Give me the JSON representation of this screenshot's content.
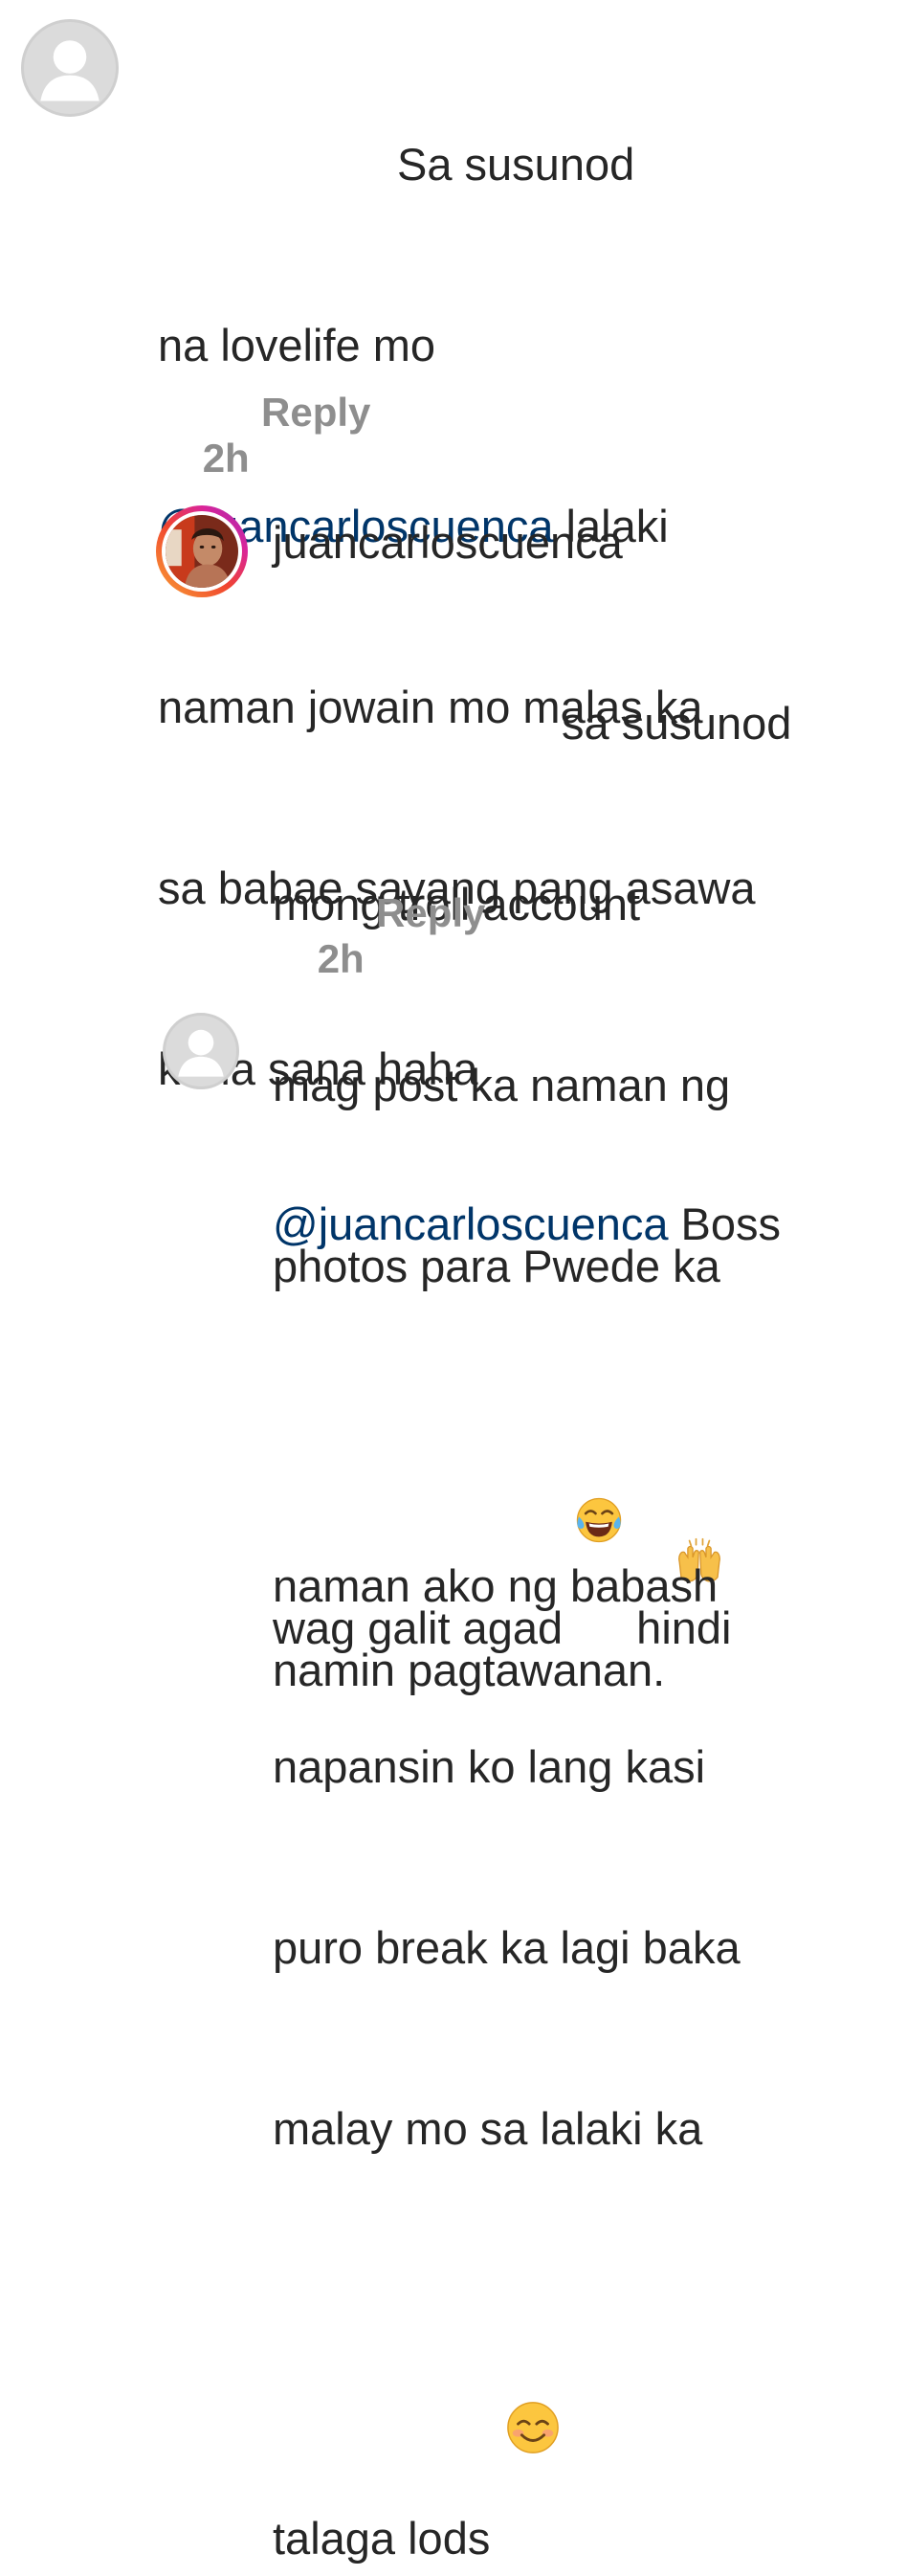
{
  "comments": [
    {
      "lines": {
        "l1": "Sa susunod",
        "l2": "na lovelife mo",
        "l3_mention": "@juancarloscuenca",
        "l3_rest": " lalaki",
        "l4": "naman jowain mo malas ka",
        "l5": "sa babae sayang pang asawa",
        "l6": "kana sana haha"
      },
      "time": "2h",
      "reply": "Reply",
      "avatar": "default-avatar-icon"
    },
    {
      "username": "juancarloscuenca",
      "lines": {
        "l1": "sa susunod",
        "l2": "mong troll account",
        "l3": "mag post ka naman ng",
        "l4": "photos para Pwede ka",
        "l5": "namin pagtawanan."
      },
      "emoji": "raising-hands-emoji",
      "time": "2h",
      "reply": "Reply",
      "avatar": "profile-photo"
    },
    {
      "lines": {
        "l1_mention": "@juancarloscuenca",
        "l1_rest": " Boss",
        "l2_a": "wag galit agad",
        "l2_b": " hindi",
        "l3": "naman ako ng babash",
        "l4": "napansin ko lang kasi",
        "l5": "puro break ka lagi baka",
        "l6": "malay mo sa lalaki ka",
        "l7": "talaga lods"
      },
      "emojis": [
        "tears-of-joy-emoji",
        "smiling-face-emoji"
      ],
      "avatar": "default-avatar-icon"
    }
  ],
  "colors": {
    "text": "#262626",
    "mention": "#003569",
    "meta": "#8e8e8e"
  }
}
